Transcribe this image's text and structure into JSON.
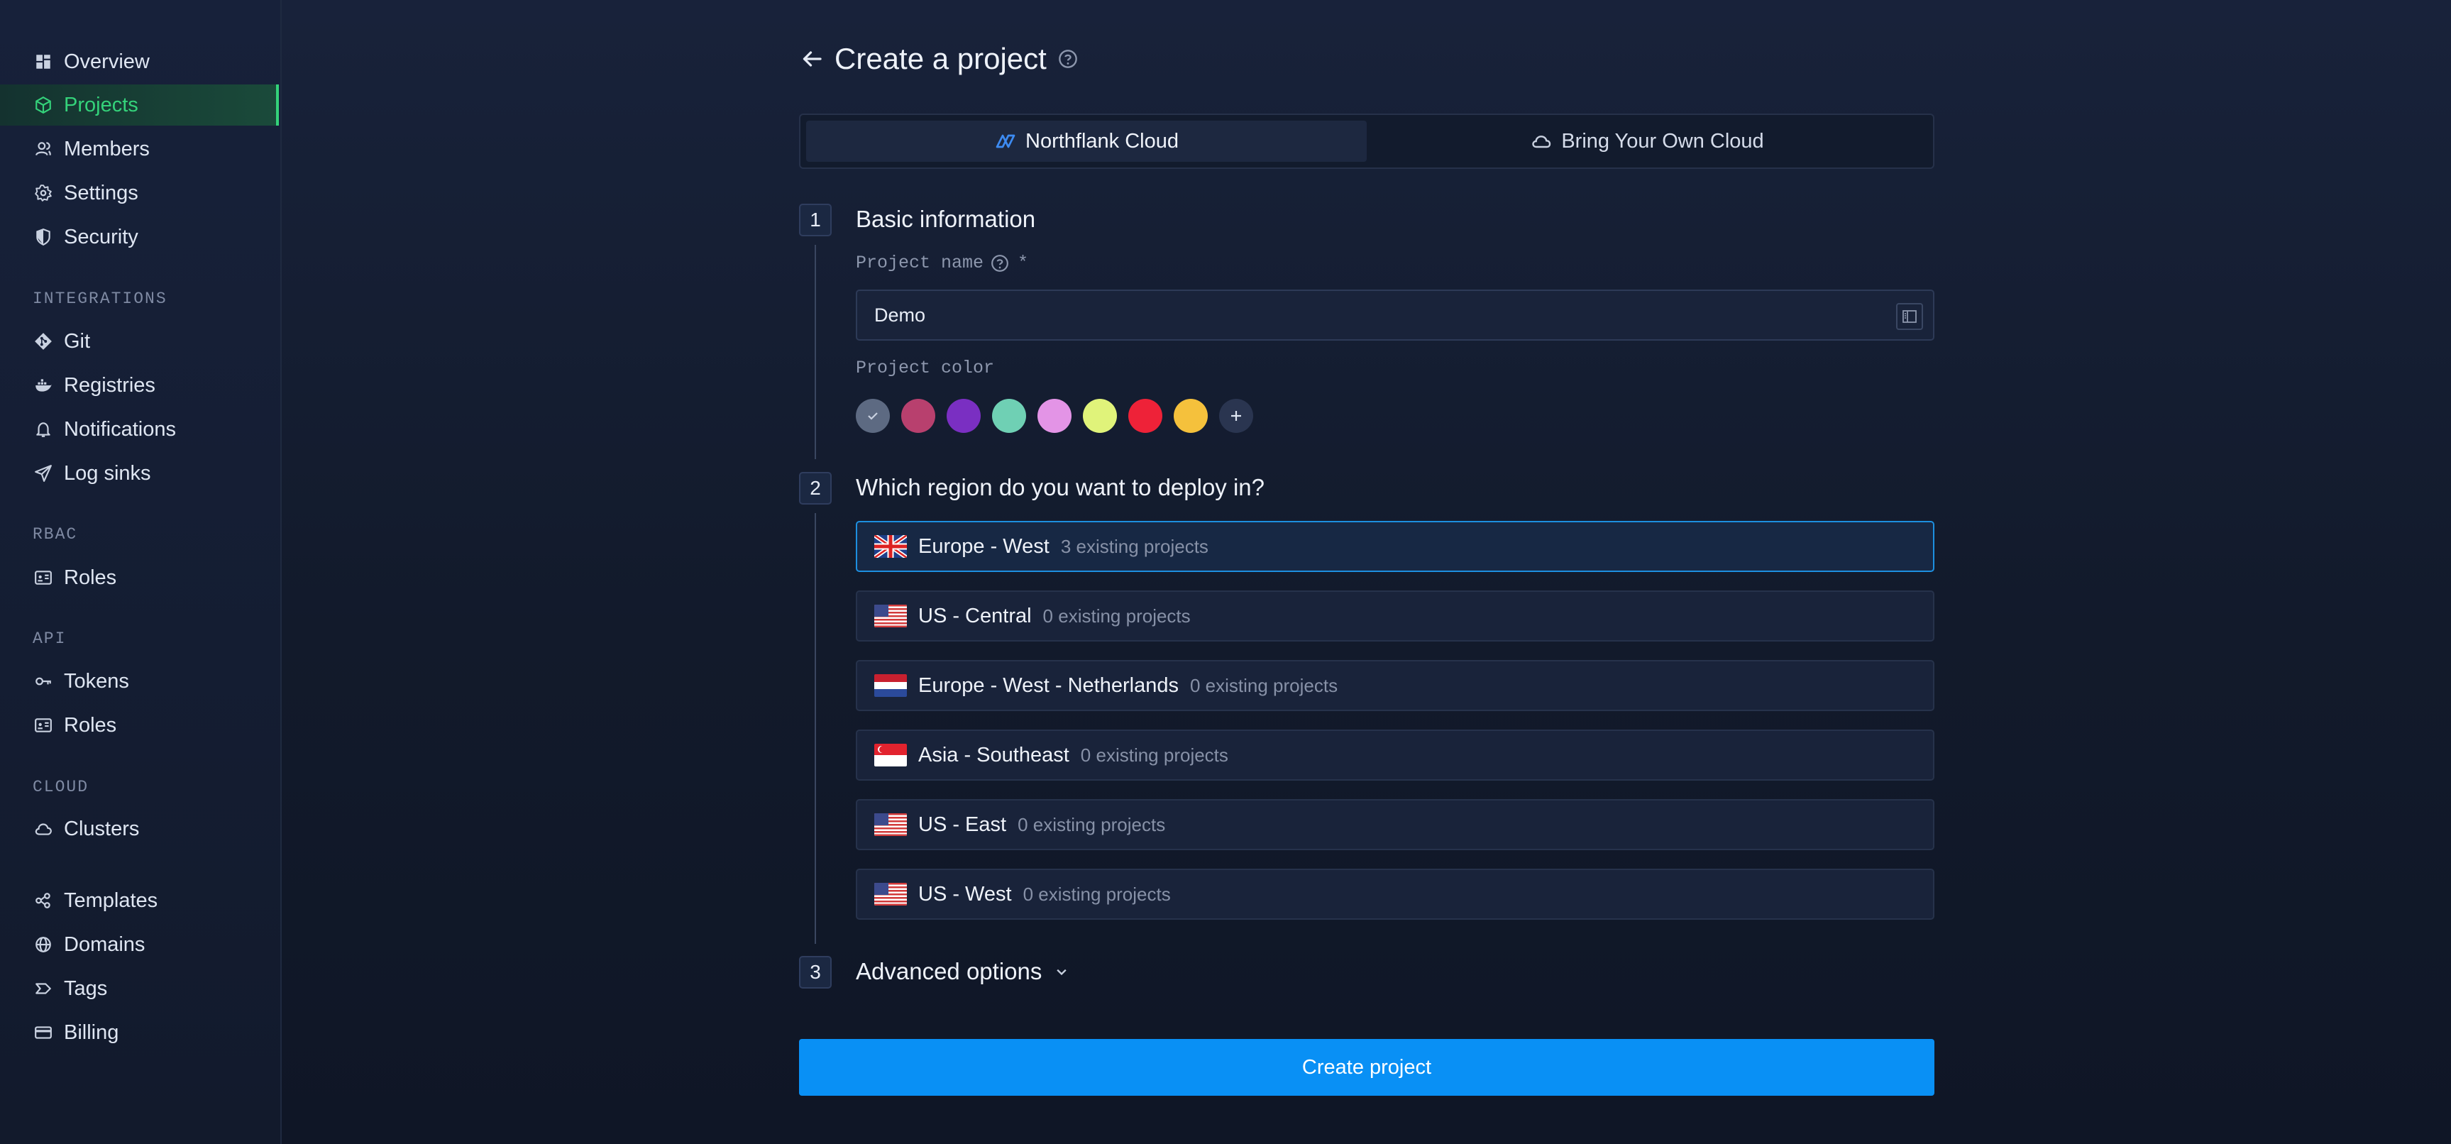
{
  "sidebar": {
    "top_items": [
      {
        "label": "Overview",
        "icon": "grid-icon"
      },
      {
        "label": "Projects",
        "icon": "cube-icon",
        "active": true
      },
      {
        "label": "Members",
        "icon": "users-icon"
      },
      {
        "label": "Settings",
        "icon": "gear-icon"
      },
      {
        "label": "Security",
        "icon": "shield-icon"
      }
    ],
    "sections": [
      {
        "label": "INTEGRATIONS",
        "items": [
          {
            "label": "Git",
            "icon": "git-icon"
          },
          {
            "label": "Registries",
            "icon": "docker-icon"
          },
          {
            "label": "Notifications",
            "icon": "bell-icon"
          },
          {
            "label": "Log sinks",
            "icon": "send-icon"
          }
        ]
      },
      {
        "label": "RBAC",
        "items": [
          {
            "label": "Roles",
            "icon": "id-card-icon"
          }
        ]
      },
      {
        "label": "API",
        "items": [
          {
            "label": "Tokens",
            "icon": "key-icon"
          },
          {
            "label": "Roles",
            "icon": "id-card-icon"
          }
        ]
      },
      {
        "label": "CLOUD",
        "items": [
          {
            "label": "Clusters",
            "icon": "cloud-icon"
          }
        ]
      }
    ],
    "bottom_items": [
      {
        "label": "Templates",
        "icon": "nodes-icon"
      },
      {
        "label": "Domains",
        "icon": "globe-icon"
      },
      {
        "label": "Tags",
        "icon": "tag-icon"
      },
      {
        "label": "Billing",
        "icon": "card-icon"
      }
    ]
  },
  "header": {
    "title": "Create a project"
  },
  "tabs": [
    {
      "label": "Northflank Cloud",
      "active": true
    },
    {
      "label": "Bring Your Own Cloud",
      "active": false
    }
  ],
  "steps": {
    "basic": {
      "number": "1",
      "title": "Basic information"
    },
    "region": {
      "number": "2",
      "title": "Which region do you want to deploy in?"
    },
    "advanced": {
      "number": "3",
      "title": "Advanced options"
    }
  },
  "form": {
    "project_name_label": "Project name",
    "required_marker": "*",
    "project_name_value": "Demo",
    "project_color_label": "Project color",
    "colors": [
      "#5d6a82",
      "#b8406e",
      "#7a2fc2",
      "#6fd0b4",
      "#e394e6",
      "#e0f37a",
      "#ee2238",
      "#f5c13c"
    ],
    "selected_color_index": 0
  },
  "regions": [
    {
      "name": "Europe - West",
      "count": "3 existing projects",
      "flag": "uk",
      "selected": true
    },
    {
      "name": "US - Central",
      "count": "0 existing projects",
      "flag": "us",
      "selected": false
    },
    {
      "name": "Europe - West - Netherlands",
      "count": "0 existing projects",
      "flag": "nl",
      "selected": false
    },
    {
      "name": "Asia - Southeast",
      "count": "0 existing projects",
      "flag": "sg",
      "selected": false
    },
    {
      "name": "US - East",
      "count": "0 existing projects",
      "flag": "us",
      "selected": false
    },
    {
      "name": "US - West",
      "count": "0 existing projects",
      "flag": "us",
      "selected": false
    }
  ],
  "actions": {
    "create_label": "Create project"
  }
}
